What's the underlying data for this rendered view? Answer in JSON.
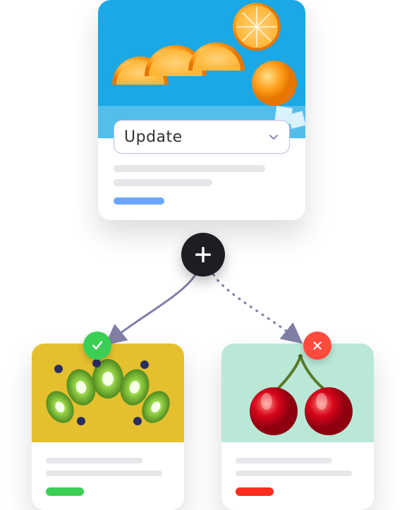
{
  "top_card": {
    "select_label": "Update",
    "accent": "#6aa6ff",
    "image": {
      "semantic": "orange-slices-on-blue"
    }
  },
  "left_card": {
    "accent": "#3ccf55",
    "status": "accepted",
    "status_icon": "check-icon",
    "image": {
      "semantic": "kiwi-slices-on-yellow"
    }
  },
  "right_card": {
    "accent": "#ff2d1e",
    "status": "rejected",
    "status_icon": "close-icon",
    "image": {
      "semantic": "cherries-on-mint"
    }
  },
  "center_action": "plus-icon"
}
